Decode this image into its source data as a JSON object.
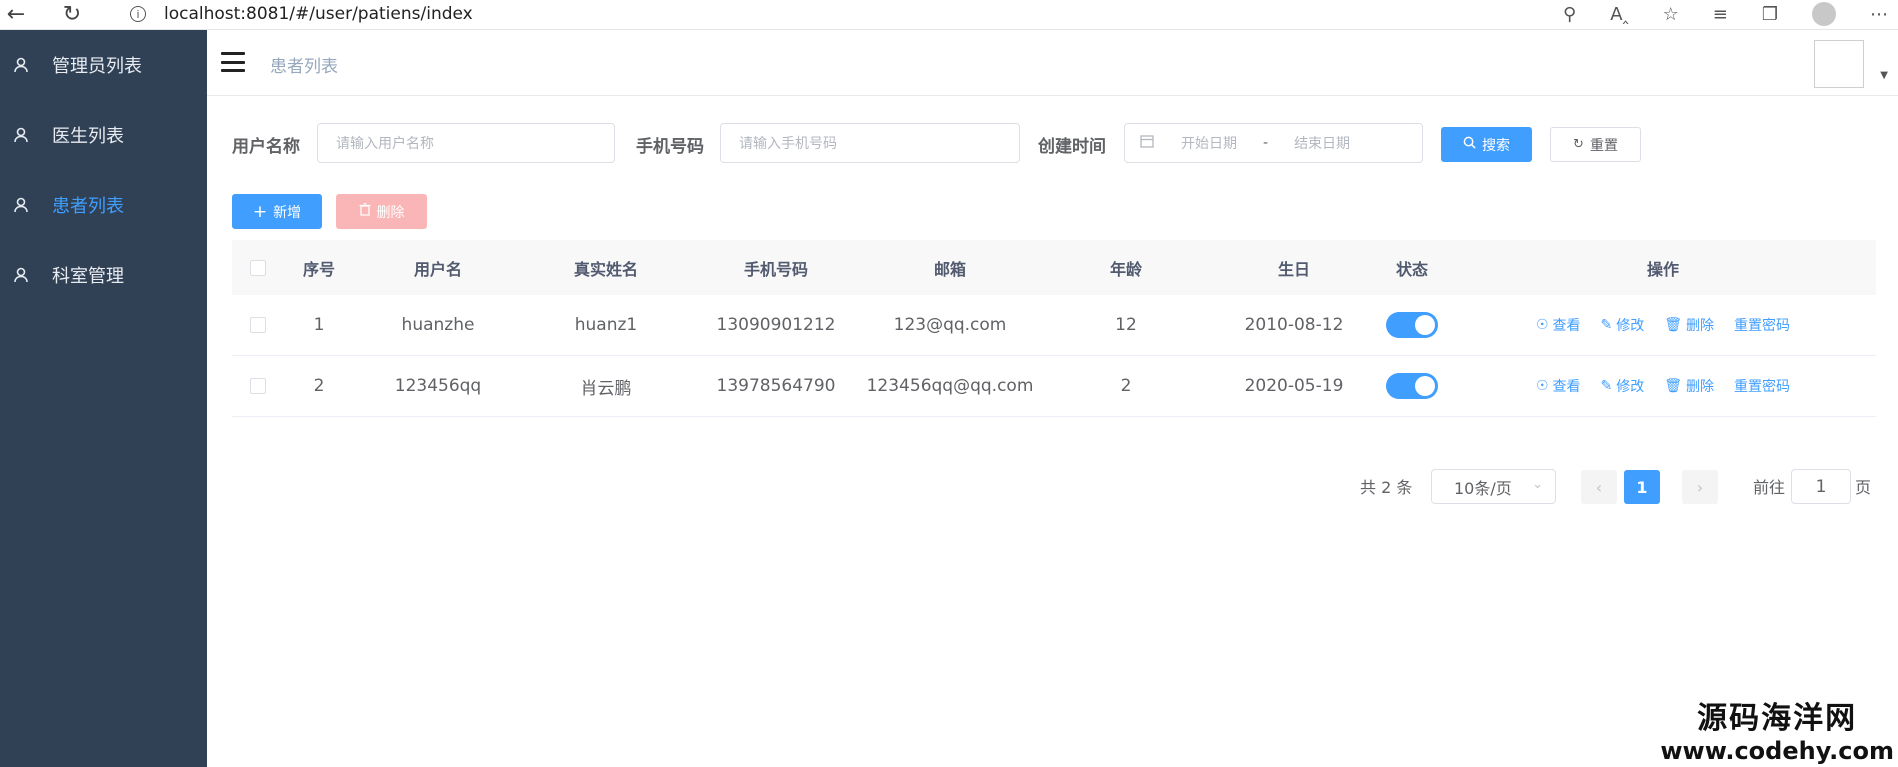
{
  "browser": {
    "url": "localhost:8081/#/user/patiens/index",
    "info_icon": "info-icon"
  },
  "sidebar": {
    "items": [
      {
        "label": "管理员列表",
        "active": false
      },
      {
        "label": "医生列表",
        "active": false
      },
      {
        "label": "患者列表",
        "active": true
      },
      {
        "label": "科室管理",
        "active": false
      }
    ]
  },
  "header": {
    "breadcrumb": "患者列表"
  },
  "search": {
    "username_label": "用户名称",
    "username_placeholder": "请输入用户名称",
    "phone_label": "手机号码",
    "phone_placeholder": "请输入手机号码",
    "created_label": "创建时间",
    "start_placeholder": "开始日期",
    "range_sep": "-",
    "end_placeholder": "结束日期",
    "search_btn": "搜索",
    "reset_btn": "重置"
  },
  "toolbar": {
    "add_btn": "新增",
    "delete_btn": "删除"
  },
  "table": {
    "columns": [
      "序号",
      "用户名",
      "真实姓名",
      "手机号码",
      "邮箱",
      "年龄",
      "生日",
      "状态",
      "操作"
    ],
    "rows": [
      {
        "no": "1",
        "username": "huanzhe",
        "realname": "huanz1",
        "phone": "13090901212",
        "email": "123@qq.com",
        "age": "12",
        "birthday": "2010-08-12",
        "status": true
      },
      {
        "no": "2",
        "username": "123456qq",
        "realname": "肖云鹏",
        "phone": "13978564790",
        "email": "123456qq@qq.com",
        "age": "2",
        "birthday": "2020-05-19",
        "status": true
      }
    ],
    "ops": {
      "view": "查看",
      "edit": "修改",
      "delete": "删除",
      "reset_pwd": "重置密码"
    }
  },
  "pagination": {
    "total_text": "共 2 条",
    "page_size": "10条/页",
    "current_page": "1",
    "goto_label": "前往",
    "goto_value": "1",
    "page_suffix": "页"
  },
  "watermark": {
    "line1": "源码海洋网",
    "line2": "www.codehy.com"
  },
  "colors": {
    "primary": "#409eff",
    "sidebar_bg": "#304156",
    "danger_disabled": "#fab6b6"
  }
}
